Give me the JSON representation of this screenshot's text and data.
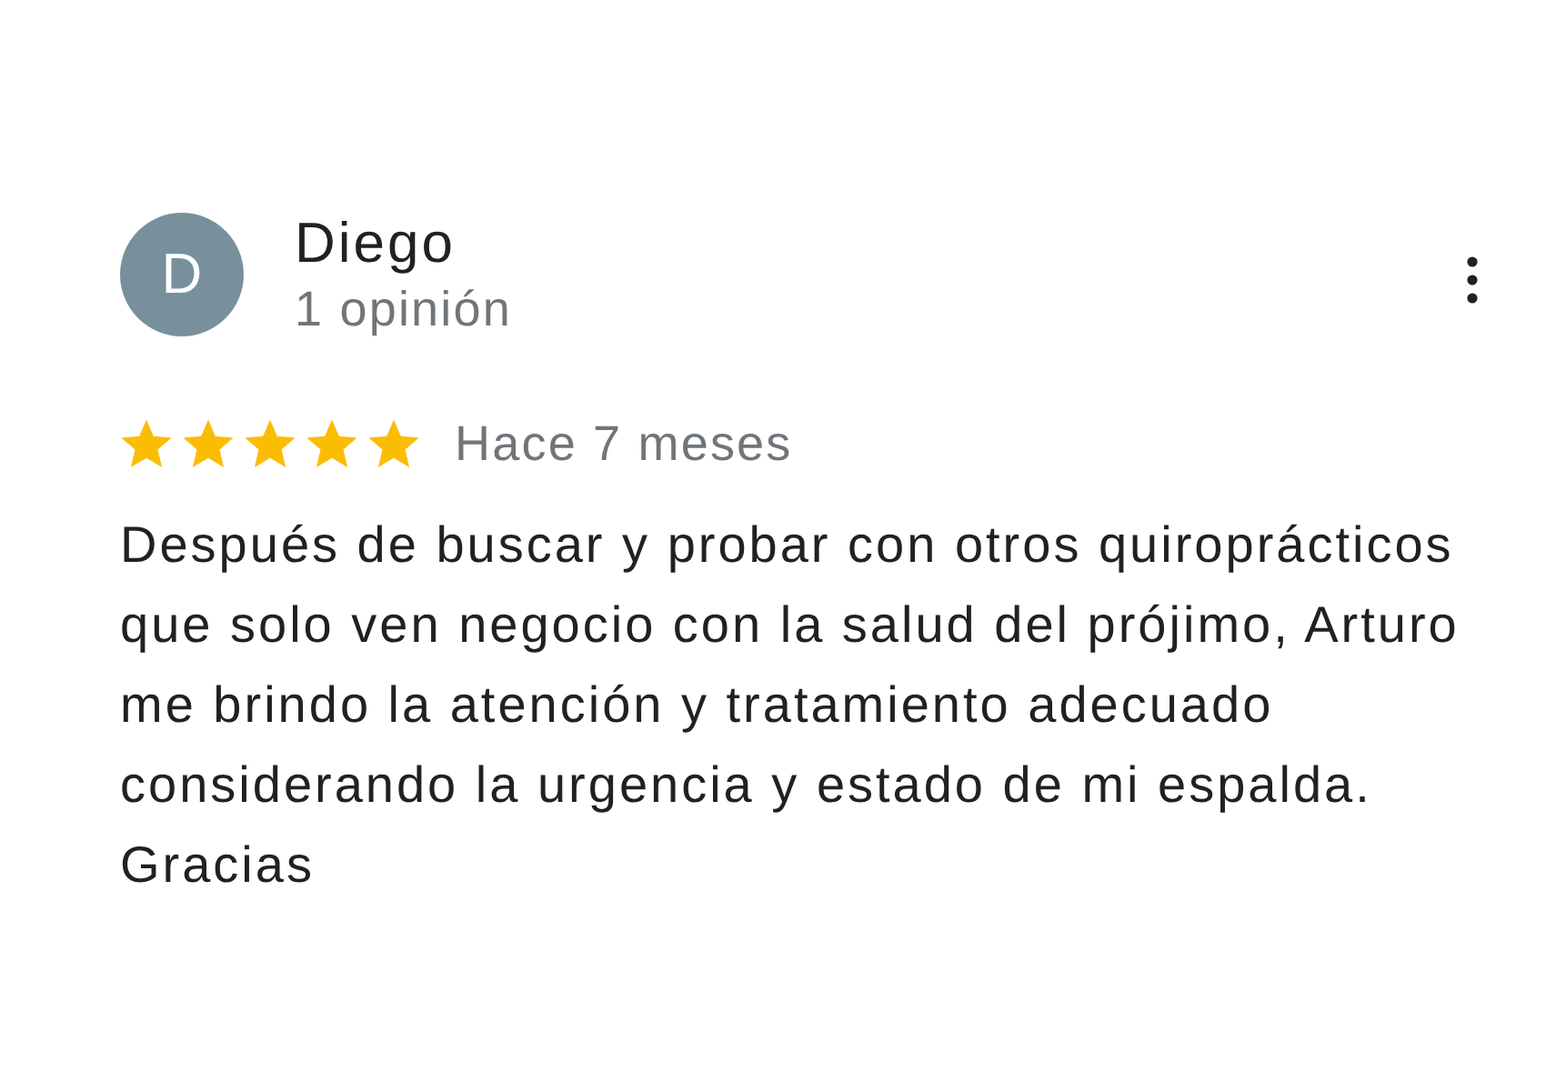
{
  "review": {
    "author": {
      "initial": "D",
      "name": "Diego",
      "review_count": "1 opinión"
    },
    "stars": 5,
    "time": "Hace 7 meses",
    "text": "Después de buscar y probar con otros quiroprácticos que solo ven negocio con la salud del prójimo, Arturo me brindo la atención y tratamiento adecuado considerando la urgencia y estado de mi espalda.\nGracias"
  }
}
